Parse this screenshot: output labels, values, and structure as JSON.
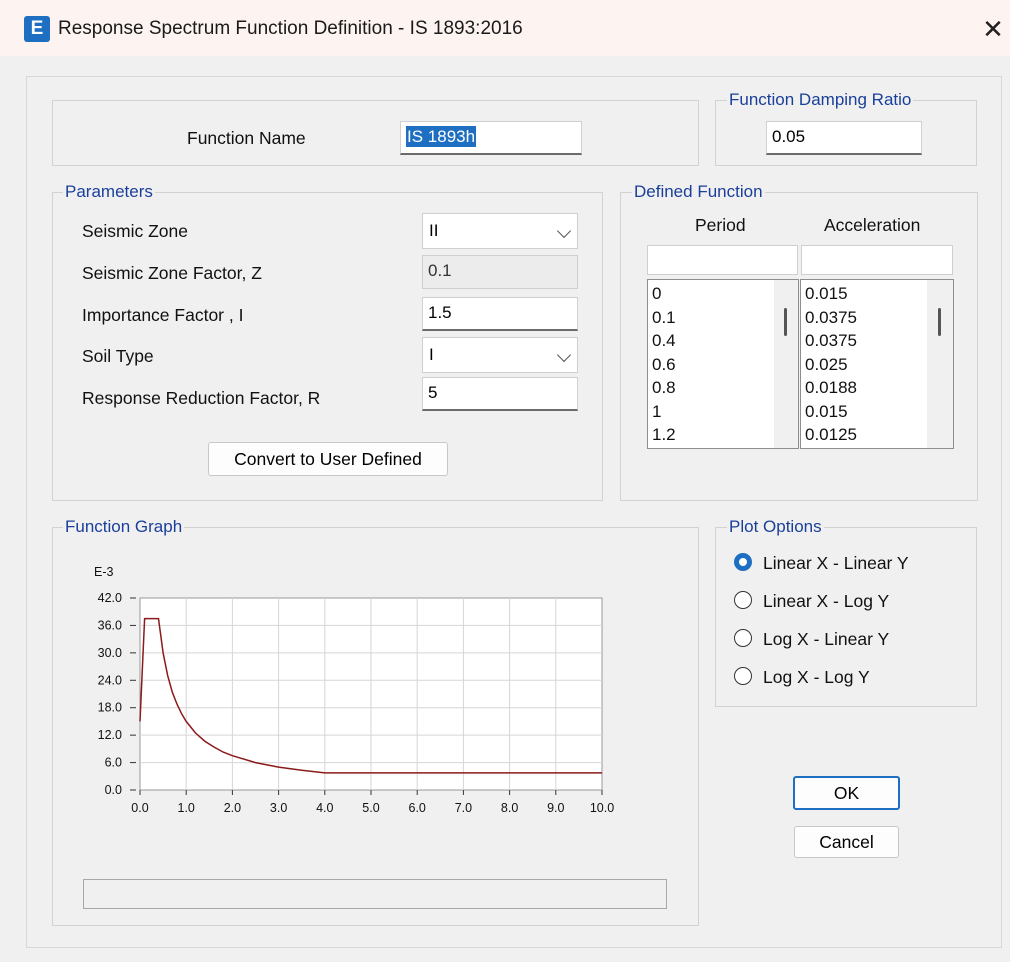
{
  "window": {
    "title": "Response Spectrum Function Definition - IS 1893:2016",
    "app_icon_letter": "E",
    "close_glyph": "✕"
  },
  "function_name": {
    "label": "Function Name",
    "value": "IS 1893h"
  },
  "damping": {
    "legend": "Function Damping Ratio",
    "value": "0.05"
  },
  "parameters": {
    "legend": "Parameters",
    "seismic_zone": {
      "label": "Seismic Zone",
      "value": "II"
    },
    "zone_factor": {
      "label": "Seismic Zone Factor, Z",
      "value": "0.1"
    },
    "importance_factor": {
      "label": "Importance Factor , I",
      "value": "1.5"
    },
    "soil_type": {
      "label": "Soil Type",
      "value": "I"
    },
    "response_reduction": {
      "label": "Response Reduction Factor, R",
      "value": "5"
    },
    "convert_button": "Convert to User Defined"
  },
  "defined_function": {
    "legend": "Defined Function",
    "headers": [
      "Period",
      "Acceleration"
    ],
    "periods": [
      "0",
      "0.1",
      "0.4",
      "0.6",
      "0.8",
      "1",
      "1.2"
    ],
    "accelerations": [
      "0.015",
      "0.0375",
      "0.0375",
      "0.025",
      "0.0188",
      "0.015",
      "0.0125"
    ]
  },
  "function_graph": {
    "legend": "Function Graph"
  },
  "plot_options": {
    "legend": "Plot Options",
    "options": [
      {
        "label": "Linear X - Linear Y",
        "checked": true
      },
      {
        "label": "Linear X - Log Y",
        "checked": false
      },
      {
        "label": "Log X - Linear Y",
        "checked": false
      },
      {
        "label": "Log X - Log Y",
        "checked": false
      }
    ]
  },
  "buttons": {
    "ok": "OK",
    "cancel": "Cancel"
  },
  "chart_data": {
    "type": "line",
    "y_scale_label": "E-3",
    "x_ticks": [
      "0.0",
      "1.0",
      "2.0",
      "3.0",
      "4.0",
      "5.0",
      "6.0",
      "7.0",
      "8.0",
      "9.0",
      "10.0"
    ],
    "y_ticks": [
      "0.0",
      "6.0",
      "12.0",
      "18.0",
      "24.0",
      "30.0",
      "36.0",
      "42.0"
    ],
    "xlim": [
      0,
      10
    ],
    "ylim": [
      0,
      42
    ],
    "grid": true,
    "line_color": "#8b1a1a",
    "series": [
      {
        "x": [
          0,
          0.1,
          0.4,
          0.5,
          0.6,
          0.7,
          0.8,
          0.9,
          1.0,
          1.2,
          1.4,
          1.6,
          1.8,
          2.0,
          2.5,
          3.0,
          3.5,
          4.0,
          5,
          6,
          7,
          8,
          9,
          10
        ],
        "y": [
          15,
          37.5,
          37.5,
          30,
          25,
          21.4,
          18.8,
          16.7,
          15,
          12.5,
          10.7,
          9.4,
          8.3,
          7.5,
          6,
          5,
          4.3,
          3.75,
          3.75,
          3.75,
          3.75,
          3.75,
          3.75,
          3.75
        ]
      }
    ]
  }
}
